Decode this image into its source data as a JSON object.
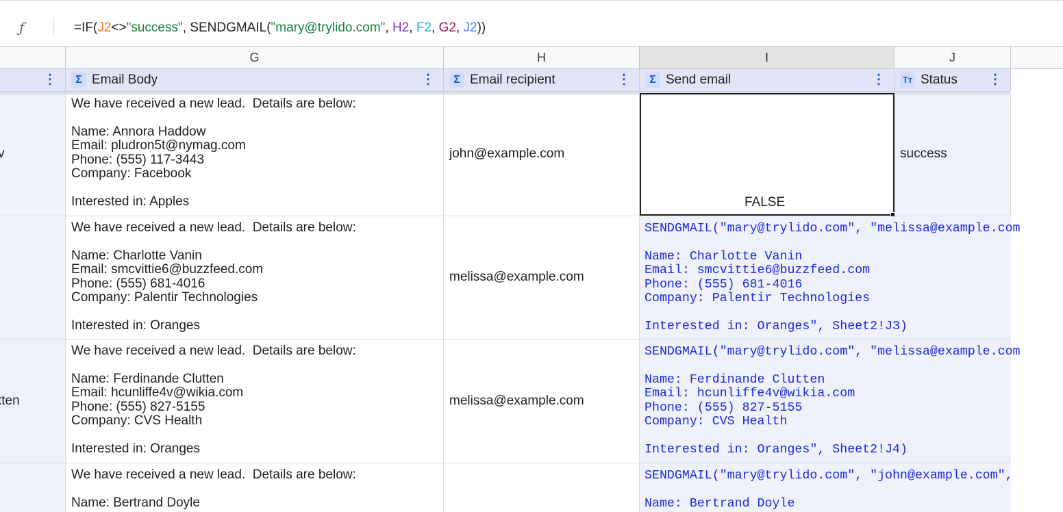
{
  "formula_bar": {
    "fx_icon": "function-icon",
    "formula_parts": {
      "p1": "=IF(",
      "p2": "J2",
      "p3": "<>",
      "p4": "\"success\"",
      "p5": ", SENDGMAIL(",
      "p6": "\"mary@trylido.com\"",
      "p7": ", ",
      "p8": "H2",
      "p9": ", ",
      "p10": "F2",
      "p11": ", ",
      "p12": "G2",
      "p13": ", ",
      "p14": "J2",
      "p15": "))"
    }
  },
  "columns": {
    "g": "G",
    "h": "H",
    "i": "I",
    "j": "J"
  },
  "table_headers": {
    "g": {
      "icon": "sigma-icon",
      "glyph": "Σ",
      "label": "Email Body"
    },
    "h": {
      "icon": "sigma-icon",
      "glyph": "Σ",
      "label": "Email recipient"
    },
    "i": {
      "icon": "sigma-icon",
      "glyph": "Σ",
      "label": "Send email"
    },
    "j": {
      "icon": "text-type-icon",
      "glyph": "Tт",
      "label": "Status"
    },
    "kebab": "⋮"
  },
  "rows": [
    {
      "left_fragment": "v",
      "body": "We have received a new lead.  Details are below:\n\nName: Annora Haddow\nEmail: pludron5t@nymag.com\nPhone: (555) 117-3443\nCompany: Facebook\n\nInterested in: Apples",
      "recipient": "john@example.com",
      "send_email": "FALSE",
      "status": "success"
    },
    {
      "left_fragment": "",
      "body": "We have received a new lead.  Details are below:\n\nName: Charlotte Vanin\nEmail: smcvittie6@buzzfeed.com\nPhone: (555) 681-4016\nCompany: Palentir Technologies\n\nInterested in: Oranges",
      "recipient": "melissa@example.com",
      "send_email": "SENDGMAIL(\"mary@trylido.com\", \"melissa@example.com\n\nName: Charlotte Vanin\nEmail: smcvittie6@buzzfeed.com\nPhone: (555) 681-4016\nCompany: Palentir Technologies\n\nInterested in: Oranges\", Sheet2!J3)",
      "status": ""
    },
    {
      "left_fragment": "tten",
      "body": "We have received a new lead.  Details are below:\n\nName: Ferdinande Clutten\nEmail: hcunliffe4v@wikia.com\nPhone: (555) 827-5155\nCompany: CVS Health\n\nInterested in: Oranges",
      "recipient": "melissa@example.com",
      "send_email": "SENDGMAIL(\"mary@trylido.com\", \"melissa@example.com\n\nName: Ferdinande Clutten\nEmail: hcunliffe4v@wikia.com\nPhone: (555) 827-5155\nCompany: CVS Health\n\nInterested in: Oranges\", Sheet2!J4)",
      "status": ""
    },
    {
      "left_fragment": "",
      "body": "We have received a new lead.  Details are below:\n\nName: Bertrand Doyle",
      "recipient": "",
      "send_email": "SENDGMAIL(\"mary@trylido.com\", \"john@example.com\", \n\nName: Bertrand Doyle",
      "status": ""
    }
  ]
}
